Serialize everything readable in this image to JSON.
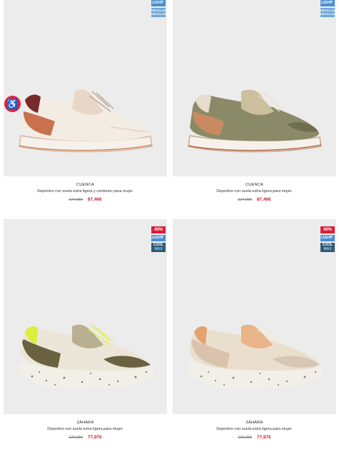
{
  "products": [
    {
      "name": "CUENCA",
      "description": "Deportivo con suela extra ligera y cordones para mujer.",
      "old_price": "124,95€",
      "price": "87,46€",
      "badges": [
        "light",
        "eco"
      ],
      "badge_light_label": "LIGHT",
      "badge_eco_label": "RECICLADA RECICLADA",
      "wishlist_icon": "wheelchair-icon",
      "colors": {
        "base": "#f3ece2",
        "accent": "#c9704f",
        "sole": "#f4f0ea",
        "heel": "#7a2a2a"
      }
    },
    {
      "name": "CUENCA",
      "description": "Deportivo con suela extra ligera para mujer.",
      "old_price": "124,95€",
      "price": "87,46€",
      "badges": [
        "light",
        "eco"
      ],
      "badge_light_label": "LIGHT",
      "badge_eco_label": "RECICLADA RECICLADA",
      "colors": {
        "base": "#8a8a68",
        "accent": "#c98a5f",
        "sole": "#f4f0ea",
        "heel": "#d8d0bf"
      }
    },
    {
      "name": "ZAHARA",
      "description": "Deportivo con suela extra ligera para mujer.",
      "old_price": "129,95€",
      "price": "77,97€",
      "badges": [
        "discount",
        "light",
        "coolmax"
      ],
      "discount_label": "40%",
      "badge_light_label": "LIGHT",
      "badge_cool_label": "COOL",
      "badge_max_label": "MAX",
      "colors": {
        "base": "#ece6d8",
        "accent": "#6a6240",
        "sole": "#f2efe8",
        "heel": "#dcef3a"
      }
    },
    {
      "name": "ZAHARA",
      "description": "Deportivo con suela extra ligera para mujer.",
      "old_price": "129,95€",
      "price": "77,97€",
      "badges": [
        "discount",
        "light",
        "coolmax"
      ],
      "discount_label": "40%",
      "badge_light_label": "LIGHT",
      "badge_cool_label": "COOL",
      "badge_max_label": "MAX",
      "colors": {
        "base": "#eadfcd",
        "accent": "#e3a26f",
        "sole": "#f2efe8",
        "heel": "#d9c3ad"
      }
    }
  ]
}
